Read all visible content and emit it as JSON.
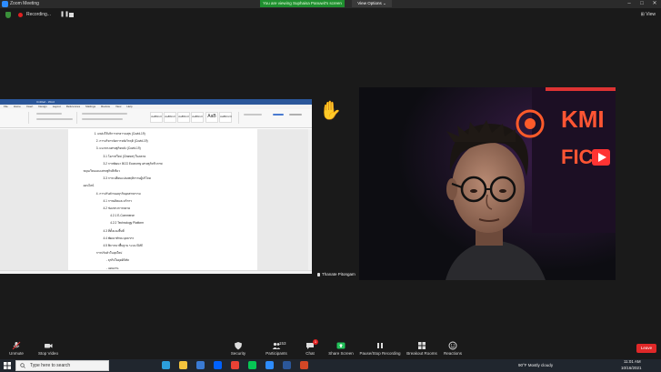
{
  "window": {
    "title": "Zoom Meeting",
    "controls": [
      "–",
      "□",
      "✕"
    ]
  },
  "banner": {
    "viewing_text": "You are viewing Suphaisa Panuwit's screen",
    "view_options_label": "View Options ⌄"
  },
  "recording": {
    "label": "Recording...",
    "pause_glyph": "❚❚"
  },
  "view": {
    "label": "⊞ View"
  },
  "word": {
    "title": "Untitled - Word",
    "tabs": [
      "File",
      "Home",
      "Insert",
      "Design",
      "Layout",
      "References",
      "Mailings",
      "Review",
      "View",
      "Help"
    ],
    "styles": [
      "AaBbCcI",
      "AaBbCcI",
      "AaBbCcI",
      "AaBbCcI",
      "AaB",
      "AaBbCcC"
    ],
    "document_lines": [
      {
        "indent": 52,
        "text": "1. แหล่งให้บริการสาธารณสุข (Covid-19)"
      },
      {
        "indent": 56,
        "text": "2. การบริหารจัดการหลังวิกฤติ (Covid-19)"
      },
      {
        "indent": 56,
        "text": "3. แนวทางเศรษฐกิจหลัง (Covid-19)"
      },
      {
        "indent": 70,
        "text": "3.1 โอกาสใหม่ (Chance) ในตลาด"
      },
      {
        "indent": 70,
        "text": "3.2 การพัฒนา BCG Economy เศรษฐกิจชีวภาพ"
      },
      {
        "indent": 30,
        "text": "หมุนเวียนและเศรษฐกิจสีเขียว"
      },
      {
        "indent": 70,
        "text": "3.3 การเปลี่ยนแปลงพฤติกรรมผู้บริโภค"
      },
      {
        "indent": 30,
        "text": "ออนไลน์"
      },
      {
        "indent": 56,
        "text": "4. การปรับตัวของธุรกิจอุตสาหกรรม"
      },
      {
        "indent": 70,
        "text": "4.1 การผลิตและบริการ"
      },
      {
        "indent": 70,
        "text": "4.2 ช่องทางการตลาด"
      },
      {
        "indent": 84,
        "text": "4.2.1 E-Commerce"
      },
      {
        "indent": 84,
        "text": "4.2.2 Technology Platform"
      },
      {
        "indent": 70,
        "text": "4.3 ที่ตั้งและพื้นที่"
      },
      {
        "indent": 70,
        "text": "4.4 พัฒนาทักษะบุคลากร"
      },
      {
        "indent": 70,
        "text": "4.5 พิจารณาพื้นฐาน ระบบ SME"
      },
      {
        "indent": 56,
        "text": "การปรับตัวในยุคใหม่"
      },
      {
        "indent": 76,
        "text": "- ธุรกิจในยุคดิจิทัล"
      },
      {
        "indent": 76,
        "text": "- แผนงาน"
      }
    ]
  },
  "participant": {
    "name": "Thanate Pitongam",
    "logo_text": "KMI",
    "logo_text_2": "FICH"
  },
  "toolbar": {
    "items": [
      {
        "id": "unmute",
        "label": "Unmute",
        "icon": "mic-muted-icon"
      },
      {
        "id": "stop-video",
        "label": "Stop Video",
        "icon": "video-icon"
      },
      {
        "id": "security",
        "label": "Security",
        "icon": "shield-icon"
      },
      {
        "id": "participants",
        "label": "Participants",
        "icon": "participants-icon",
        "count": "153"
      },
      {
        "id": "chat",
        "label": "Chat",
        "icon": "chat-icon",
        "badge": "1"
      },
      {
        "id": "share-screen",
        "label": "Share Screen",
        "icon": "share-screen-icon"
      },
      {
        "id": "pause-recording",
        "label": "Pause/Stop Recording",
        "icon": "pause-recording-icon"
      },
      {
        "id": "breakout-rooms",
        "label": "Breakout Rooms",
        "icon": "breakout-rooms-icon"
      },
      {
        "id": "reactions",
        "label": "Reactions",
        "icon": "reactions-icon"
      }
    ],
    "leave_label": "Leave"
  },
  "taskbar": {
    "search_placeholder": "Type here to search",
    "weather": "90°F  Mostly cloudy",
    "time": "11:01 AM",
    "date": "10/16/2021",
    "apps": [
      {
        "name": "edge-icon",
        "color": "#2c9fdc"
      },
      {
        "name": "file-explorer-icon",
        "color": "#f3c33d"
      },
      {
        "name": "store-icon",
        "color": "#3a7bd5"
      },
      {
        "name": "dropbox-icon",
        "color": "#0061fe"
      },
      {
        "name": "chrome-icon",
        "color": "#e94235"
      },
      {
        "name": "line-icon",
        "color": "#06c755"
      },
      {
        "name": "zoom-icon",
        "color": "#2d8cff"
      },
      {
        "name": "word-icon",
        "color": "#2b579a"
      },
      {
        "name": "powerpoint-icon",
        "color": "#d24726"
      }
    ]
  }
}
